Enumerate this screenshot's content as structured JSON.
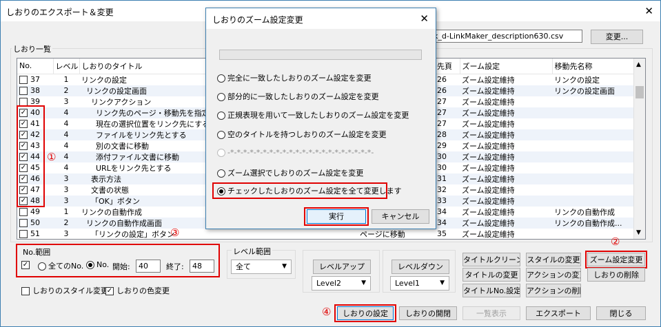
{
  "window": {
    "title": "しおりのエクスポート＆変更",
    "close": "✕"
  },
  "file": {
    "value": "k_d-LinkMaker_description630.csv",
    "change_button": "変更..."
  },
  "list": {
    "group_label": "しおり一覧",
    "columns": [
      "No.",
      "レベル",
      "しおりのタイトル",
      "先頁",
      "ズーム設定",
      "移動先名称"
    ],
    "rows": [
      {
        "checked": false,
        "no": "37",
        "level": "1",
        "title": "リンクの設定",
        "page": "26",
        "zoom": "ズーム設定維持",
        "dest": "リンクの設定"
      },
      {
        "checked": false,
        "no": "38",
        "level": "2",
        "title": "  リンクの設定画面",
        "page": "26",
        "zoom": "ズーム設定維持",
        "dest": "リンクの設定画面"
      },
      {
        "checked": false,
        "no": "39",
        "level": "3",
        "title": "    リンクアクション",
        "page": "27",
        "zoom": "ズーム設定維持",
        "dest": ""
      },
      {
        "checked": true,
        "no": "40",
        "level": "4",
        "title": "      リンク先のページ・移動先を指定",
        "page": "27",
        "zoom": "ズーム設定維持",
        "dest": ""
      },
      {
        "checked": true,
        "no": "41",
        "level": "4",
        "title": "      現在の選択位置をリンク先にする",
        "page": "27",
        "zoom": "ズーム設定維持",
        "dest": ""
      },
      {
        "checked": true,
        "no": "42",
        "level": "4",
        "title": "      ファイルをリンク先とする",
        "page": "28",
        "zoom": "ズーム設定維持",
        "dest": ""
      },
      {
        "checked": true,
        "no": "43",
        "level": "4",
        "title": "      別の文書に移動",
        "page": "29",
        "zoom": "ズーム設定維持",
        "dest": ""
      },
      {
        "checked": true,
        "no": "44",
        "level": "4",
        "title": "      添付ファイル文書に移動",
        "page": "30",
        "zoom": "ズーム設定維持",
        "dest": ""
      },
      {
        "checked": true,
        "no": "45",
        "level": "4",
        "title": "      URLをリンク先とする",
        "page": "30",
        "zoom": "ズーム設定維持",
        "dest": ""
      },
      {
        "checked": true,
        "no": "46",
        "level": "3",
        "title": "    表示方法",
        "page": "31",
        "zoom": "ズーム設定維持",
        "dest": ""
      },
      {
        "checked": true,
        "no": "47",
        "level": "3",
        "title": "    文書の状態",
        "page": "32",
        "zoom": "ズーム設定維持",
        "dest": ""
      },
      {
        "checked": true,
        "no": "48",
        "level": "3",
        "title": "    「OK」ボタン",
        "page": "33",
        "zoom": "ズーム設定維持",
        "dest": ""
      },
      {
        "checked": false,
        "no": "49",
        "level": "1",
        "title": "リンクの自動作成",
        "page": "34",
        "zoom": "ズーム設定維持",
        "dest": "リンクの自動作成"
      },
      {
        "checked": false,
        "no": "50",
        "level": "2",
        "title": "  リンクの自動作成画面",
        "page": "34",
        "zoom": "ズーム設定維持",
        "dest": "リンクの自動作成..."
      },
      {
        "checked": false,
        "no": "51",
        "level": "3",
        "title": "    「リンクの設定」ボタン",
        "page": "35",
        "zoom": "ズーム設定維持",
        "dest": ""
      }
    ],
    "row51_middle": "ページに移動"
  },
  "markers": {
    "m1": "①",
    "m2": "②",
    "m3": "③",
    "m4": "④"
  },
  "no_range": {
    "label": "No.範囲",
    "all_label": "全てのNo.",
    "no_label": "No.",
    "start_label": "開始:",
    "start": "40",
    "end_label": "終了:",
    "end": "48"
  },
  "level_range": {
    "label": "レベル範囲",
    "value": "全て"
  },
  "level_up": {
    "button": "レベルアップ",
    "value": "Level2"
  },
  "level_down": {
    "button": "レベルダウン",
    "value": "Level1"
  },
  "right_buttons": {
    "title_clean": "タイトルクリーン",
    "style_change": "スタイルの変更",
    "zoom_change": "ズーム設定変更",
    "title_change": "タイトルの変更",
    "action_change": "アクションの変更",
    "delete": "しおりの削除",
    "title_no": "タイトルNo.設定",
    "action_delete": "アクションの削除"
  },
  "checks": {
    "style_change": "しおりのスタイル変更",
    "color_change": "しおりの色変更"
  },
  "bottom": {
    "set": "しおりの設定",
    "open": "しおりの開閉",
    "list_view": "一覧表示",
    "export": "エクスポート",
    "close": "閉じる"
  },
  "dialog": {
    "title": "しおりのズーム設定変更",
    "close": "✕",
    "options": [
      "完全に一致したしおりのズーム設定を変更",
      "部分的に一致したしおりのズーム設定を変更",
      "正規表現を用いて一致したしおりのズーム設定を変更",
      "空のタイトルを持つしおりのズーム設定を変更",
      "-*-*-*-*-*-*-*-*-*-*-*-*-*-*-*-*-*-*-*-*-*-*-",
      "ズーム選択でしおりのズーム設定を変更",
      "チェックしたしおりのズーム設定を全て変更します"
    ],
    "selected_index": 6,
    "run": "実行",
    "cancel": "キャンセル"
  }
}
